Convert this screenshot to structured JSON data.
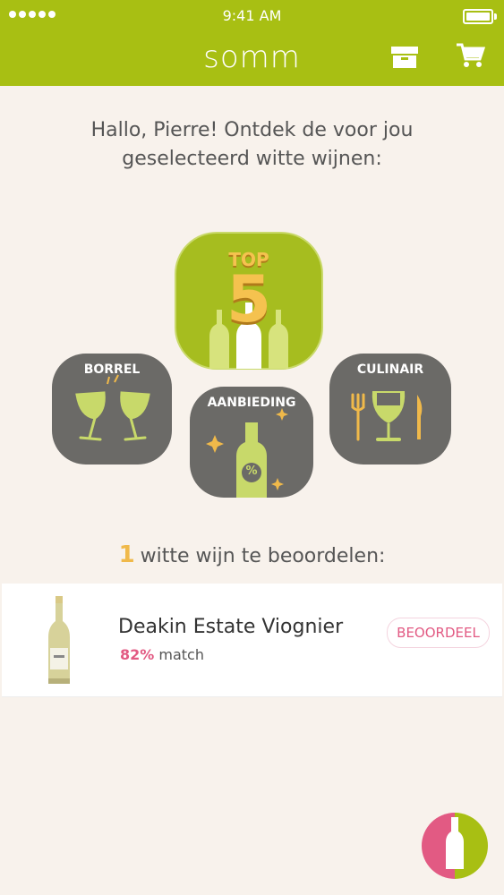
{
  "status_bar": {
    "time": "9:41 AM"
  },
  "header": {
    "logo": "somm",
    "box_icon": "box-icon",
    "cart_icon": "cart-icon",
    "color": "#a8bf13"
  },
  "greeting": {
    "line1": "Hallo, Pierre! Ontdek de voor jou",
    "line2": "geselecteerd witte wijnen:"
  },
  "categories": {
    "top5": {
      "label_top": "TOP",
      "label_num": "5"
    },
    "borrel": {
      "label": "BORREL"
    },
    "aanbieding": {
      "label": "AANBIEDING",
      "badge": "%"
    },
    "culinair": {
      "label": "CULINAIR"
    }
  },
  "rating_prompt": {
    "count": "1",
    "text": "witte wijn te beoordelen:"
  },
  "wine": {
    "name": "Deakin Estate Viognier",
    "match_pct": "82%",
    "match_label": "match",
    "button": "BEOORDEEL"
  },
  "colors": {
    "accent_green": "#a8bf13",
    "tile_gray": "#6b6a67",
    "pink": "#e25a83",
    "gold": "#f0b94a"
  }
}
